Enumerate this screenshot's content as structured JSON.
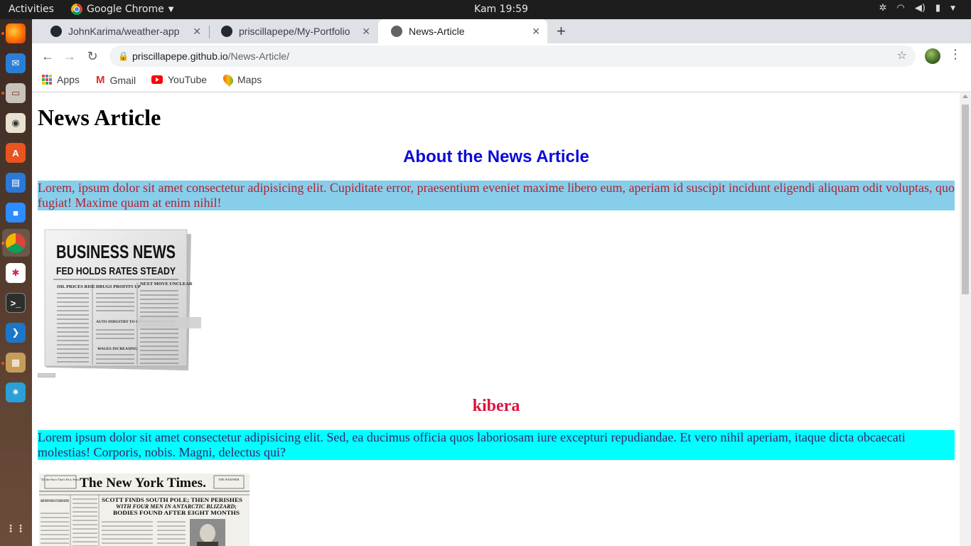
{
  "system": {
    "activities": "Activities",
    "app_name": "Google Chrome",
    "clock": "Kam 19:59"
  },
  "browser": {
    "tabs": [
      {
        "label": "JohnKarima/weather-app",
        "icon": "github-icon"
      },
      {
        "label": "priscillapepe/My-Portfolio",
        "icon": "github-icon"
      },
      {
        "label": "News-Article",
        "icon": "globe-icon",
        "active": true
      }
    ],
    "url_host": "priscillapepe.github.io",
    "url_path": "/News-Article/",
    "bookmarks": [
      {
        "label": "Apps"
      },
      {
        "label": "Gmail"
      },
      {
        "label": "YouTube"
      },
      {
        "label": "Maps"
      }
    ]
  },
  "page": {
    "title": "News Article",
    "section1": {
      "heading": "About the News Article",
      "paragraph": "Lorem, ipsum dolor sit amet consectetur adipisicing elit. Cupiditate error, praesentium eveniet maxime libero eum, aperiam id suscipit incidunt eligendi aliquam odit voluptas, quo fugiat! Maxime quam at enim nihil!",
      "image": {
        "headline": "BUSINESS NEWS",
        "subhead": "FED HOLDS RATES STEADY",
        "columns": [
          "OIL PRICES RISE",
          "DRUGS PROFITS UP",
          "NEXT MOVE UNCLEAR"
        ],
        "col2_extra": [
          "AUTO INDUSTRY TO OFFER INCENTIVES",
          "WAGES INCREASING"
        ]
      }
    },
    "section2": {
      "heading": "kibera",
      "paragraph": "Lorem ipsum dolor sit amet consectetur adipisicing elit. Sed, ea ducimus officia quos laboriosam iure excepturi repudiandae. Et vero nihil aperiam, itaque dicta obcaecati molestias! Corporis, nobis. Magni, delectus qui?",
      "image": {
        "masthead": "The New York Times.",
        "left_box": "\"All the News That's Fit to Print.\"",
        "right_box": "THE WEATHER",
        "headline1": "SCOTT FINDS SOUTH POLE; THEN PERISHES",
        "headline2": "WITH FOUR MEN IN ANTARCTIC BLIZZARD;",
        "headline3": "BODIES FOUND AFTER EIGHT MONTHS",
        "left_col": "ARMED TROOPS IN MEXICO CITY; MADERO'S RETURNS"
      }
    }
  },
  "colors": {
    "heading_blue": "#0b0bd8",
    "p1_bg": "#87ceeb",
    "p1_text": "#b22234",
    "kibera": "#dc143c",
    "p2_bg": "#00ffff",
    "p2_text": "#3a2470"
  }
}
